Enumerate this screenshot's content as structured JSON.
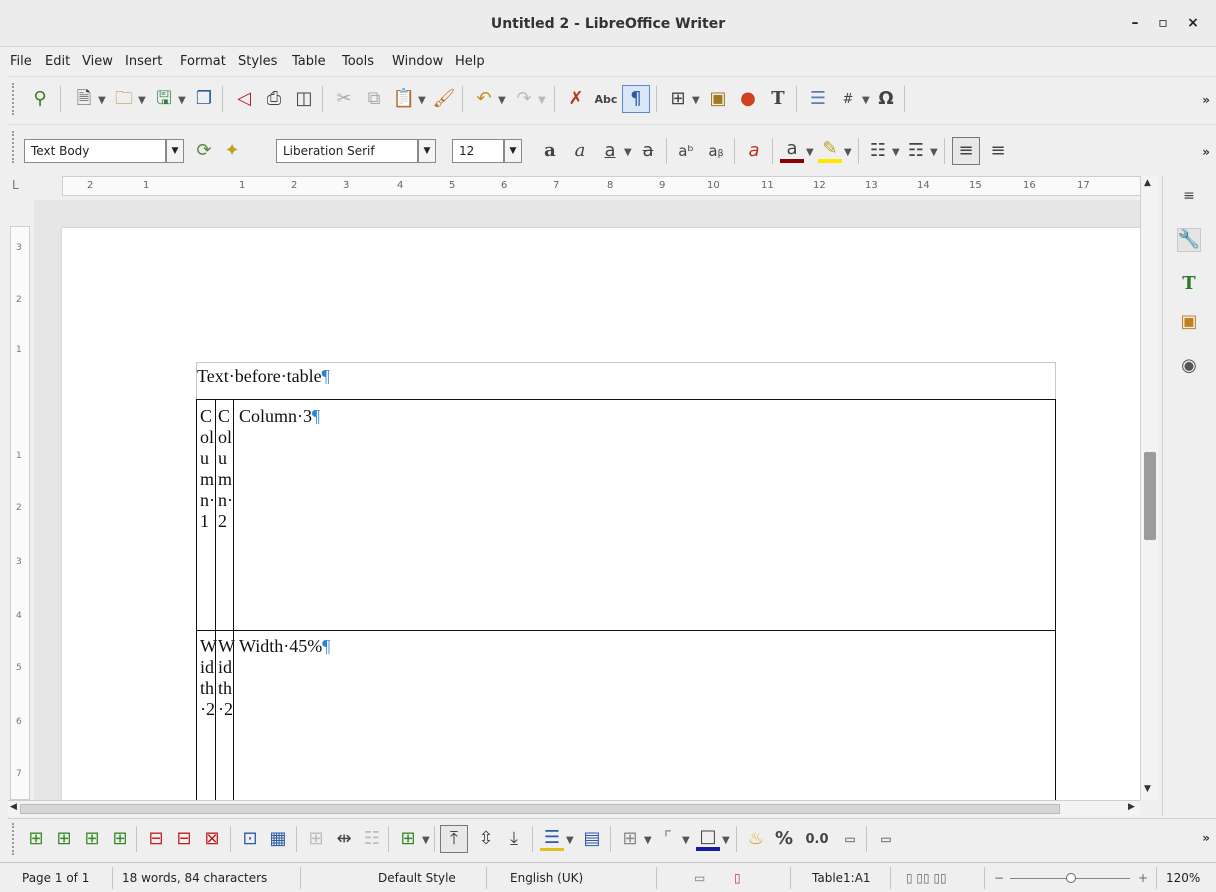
{
  "window": {
    "title": "Untitled 2 - LibreOffice Writer",
    "minimize": "–",
    "maximize": "▫",
    "close": "×"
  },
  "menu": [
    "File",
    "Edit",
    "View",
    "Insert",
    "Format",
    "Styles",
    "Table",
    "Tools",
    "Window",
    "Help"
  ],
  "format_toolbar": {
    "paragraph_style": "Text Body",
    "font_name": "Liberation Serif",
    "font_size": "12"
  },
  "ruler": {
    "corner": "L",
    "ticks": [
      "2",
      "1",
      "1",
      "2",
      "3",
      "4",
      "5",
      "6",
      "7",
      "8",
      "9",
      "10",
      "11",
      "12",
      "13",
      "14",
      "15",
      "16",
      "17"
    ]
  },
  "vertical_ruler": {
    "ticks": [
      "3",
      "2",
      "1",
      "1",
      "2",
      "3",
      "4",
      "5",
      "6",
      "7"
    ]
  },
  "document": {
    "text_before_table": "Text·before·table",
    "pilcrow": "¶",
    "table": {
      "row1": {
        "col1": "Column·1",
        "col2": "Column·2",
        "col3": "Column·3"
      },
      "row2": {
        "col1": "Width·2",
        "col2": "Width·2",
        "col3": "Width·45%"
      }
    }
  },
  "status": {
    "page": "Page 1 of 1",
    "words": "18 words, 84 characters",
    "page_style": "Default Style",
    "language": "English (UK)",
    "table_cell": "Table1:A1",
    "zoom": "120%",
    "zoom_minus": "−",
    "zoom_plus": "+"
  },
  "table_toolbar": {
    "percent": "%",
    "number": "0.0"
  },
  "icons": {
    "spell": "Abc",
    "special_char": "Ω",
    "more": "»",
    "deck_menu": "≡"
  }
}
